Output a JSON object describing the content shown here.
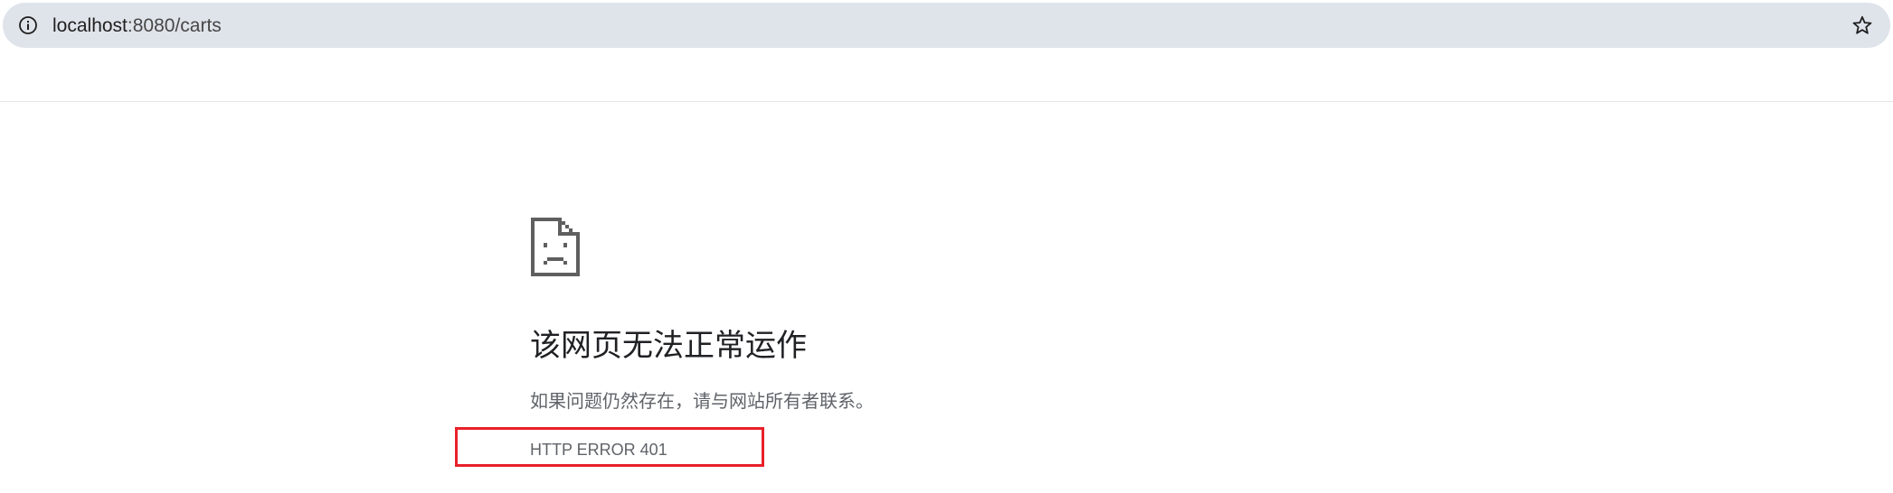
{
  "browser": {
    "address_bar": {
      "url_host": "localhost",
      "url_rest": ":8080/carts",
      "info_icon": "info-icon",
      "bookmark_icon": "star-icon"
    }
  },
  "error_page": {
    "icon": "sad-page-icon",
    "heading": "该网页无法正常运作",
    "message": "如果问题仍然存在，请与网站所有者联系。",
    "error_code": "HTTP ERROR 401"
  },
  "annotation": {
    "highlight_color": "#e8202a"
  }
}
